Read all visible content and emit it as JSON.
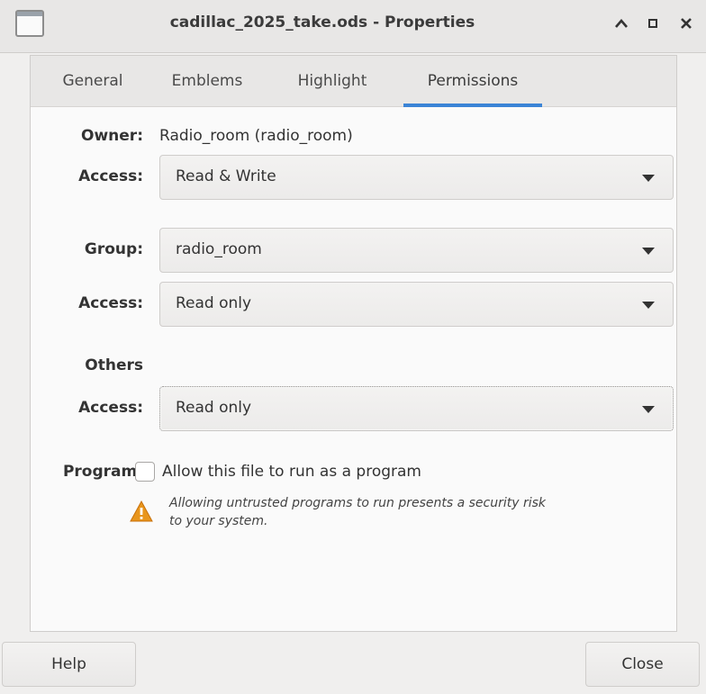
{
  "window": {
    "title": "cadillac_2025_take.ods - Properties",
    "icons": {
      "app": "window-icon",
      "up": "chevron-up-icon",
      "maximize": "maximize-icon",
      "close": "close-icon"
    },
    "up_glyph": "^",
    "close_glyph": "X"
  },
  "tabs": [
    {
      "label": "General",
      "active": false
    },
    {
      "label": "Emblems",
      "active": false
    },
    {
      "label": "Highlight",
      "active": false
    },
    {
      "label": "Permissions",
      "active": true
    }
  ],
  "permissions": {
    "owner_label": "Owner:",
    "owner_value": "Radio_room (radio_room)",
    "owner_access_label": "Access:",
    "owner_access_value": "Read & Write",
    "group_label": "Group:",
    "group_value": "radio_room",
    "group_access_label": "Access:",
    "group_access_value": "Read only",
    "others_label": "Others",
    "others_access_label": "Access:",
    "others_access_value": "Read only",
    "program_label": "Program:",
    "program_checkbox_label": "Allow this file to run as a program",
    "program_checked": false,
    "warning_line1": "Allowing untrusted programs to run presents a security risk",
    "warning_line2": "to your system."
  },
  "buttons": {
    "help": "Help",
    "close": "Close"
  },
  "colors": {
    "accent": "#3b84d6",
    "warning": "#e8951c"
  }
}
